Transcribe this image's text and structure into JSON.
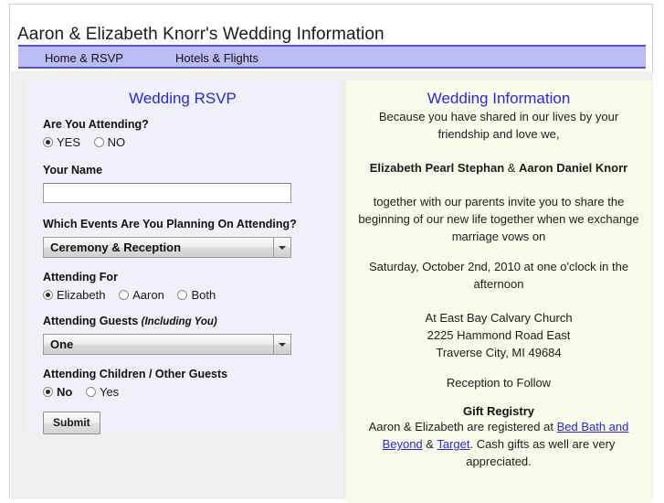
{
  "site": {
    "title": "Aaron & Elizabeth Knorr's Wedding Information"
  },
  "nav": {
    "items": [
      {
        "label": "Home & RSVP"
      },
      {
        "label": "Hotels & Flights"
      }
    ]
  },
  "rsvp": {
    "heading": "Wedding RSVP",
    "attending": {
      "label": "Are You Attending?",
      "options": [
        {
          "label": "YES",
          "selected": true
        },
        {
          "label": "NO",
          "selected": false
        }
      ]
    },
    "your_name": {
      "label": "Your Name",
      "value": "",
      "placeholder": ""
    },
    "events": {
      "label": "Which Events Are You Planning On Attending?",
      "selected": "Ceremony & Reception"
    },
    "attending_for": {
      "label": "Attending For",
      "options": [
        {
          "label": "Elizabeth",
          "selected": true
        },
        {
          "label": "Aaron",
          "selected": false
        },
        {
          "label": "Both",
          "selected": false
        }
      ]
    },
    "guests": {
      "label": "Attending Guests",
      "label_sub": "(Including You)",
      "selected": "One"
    },
    "children": {
      "label": "Attending Children / Other Guests",
      "options": [
        {
          "label": "No",
          "selected": true
        },
        {
          "label": "Yes",
          "selected": false
        }
      ]
    },
    "submit_label": "Submit"
  },
  "info": {
    "heading": "Wedding Information",
    "intro": "Because you have shared in our lives by your friendship and love we,",
    "bride": "Elizabeth Pearl Stephan",
    "amp": " & ",
    "groom": "Aaron Daniel Knorr",
    "invite": "together with our parents invite you to share the beginning of our new life together when we exchange marriage vows on",
    "date": "Saturday, October 2nd, 2010 at one o'clock in the afternoon",
    "venue_name": "At East Bay Calvary Church",
    "venue_street": "2225 Hammond Road East",
    "venue_city": "Traverse City, MI 49684",
    "reception": "Reception to Follow",
    "registry_heading": "Gift Registry",
    "registry_pre": "Aaron & Elizabeth are registered at ",
    "registry_link1": "Bed Bath and Beyond",
    "registry_mid": " & ",
    "registry_link2": "Target",
    "registry_post": ". Cash gifts as well are very appreciated."
  },
  "colors": {
    "nav_bg": "#bcbcf5",
    "nav_border": "#5353e0",
    "heading_blue": "#2626ee",
    "left_panel_bg": "#f0f0fa",
    "right_panel_bg": "#fbfbec",
    "page_bg": "#efefef"
  }
}
